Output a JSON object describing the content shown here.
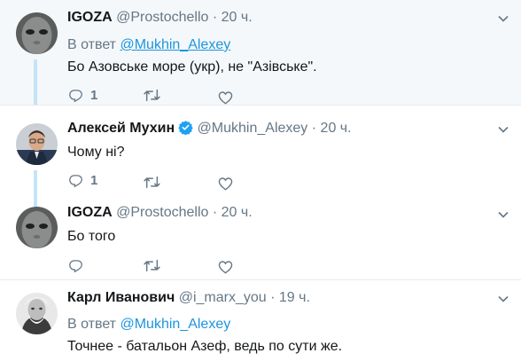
{
  "tweets": [
    {
      "name": "IGOZA",
      "handle": "@Prostochello",
      "time": "20 ч.",
      "reply_prefix": "В ответ",
      "reply_to": "@Mukhin_Alexey",
      "text": "Бо Азовське море (укр), не \"Азівське\".",
      "reply_count": "1"
    },
    {
      "name": "Алексей Мухин",
      "handle": "@Mukhin_Alexey",
      "time": "20 ч.",
      "verified": true,
      "text": "Чому ні?",
      "reply_count": "1"
    },
    {
      "name": "IGOZA",
      "handle": "@Prostochello",
      "time": "20 ч.",
      "text": "Бо того",
      "reply_count": ""
    },
    {
      "name": "Карл Иванович",
      "handle": "@i_marx_you",
      "time": "19 ч.",
      "reply_prefix": "В ответ",
      "reply_to": "@Mukhin_Alexey",
      "text": "Точнее - батальон Азеф, ведь по сути же."
    }
  ],
  "separator": "·",
  "colors": {
    "link": "#1b95e0",
    "muted": "#657786",
    "thread_line": "#c4e4f7",
    "verified": "#1da1f2"
  },
  "icons": [
    "reply-icon",
    "retweet-icon",
    "like-icon",
    "caret-down-icon",
    "verified-badge-icon"
  ]
}
